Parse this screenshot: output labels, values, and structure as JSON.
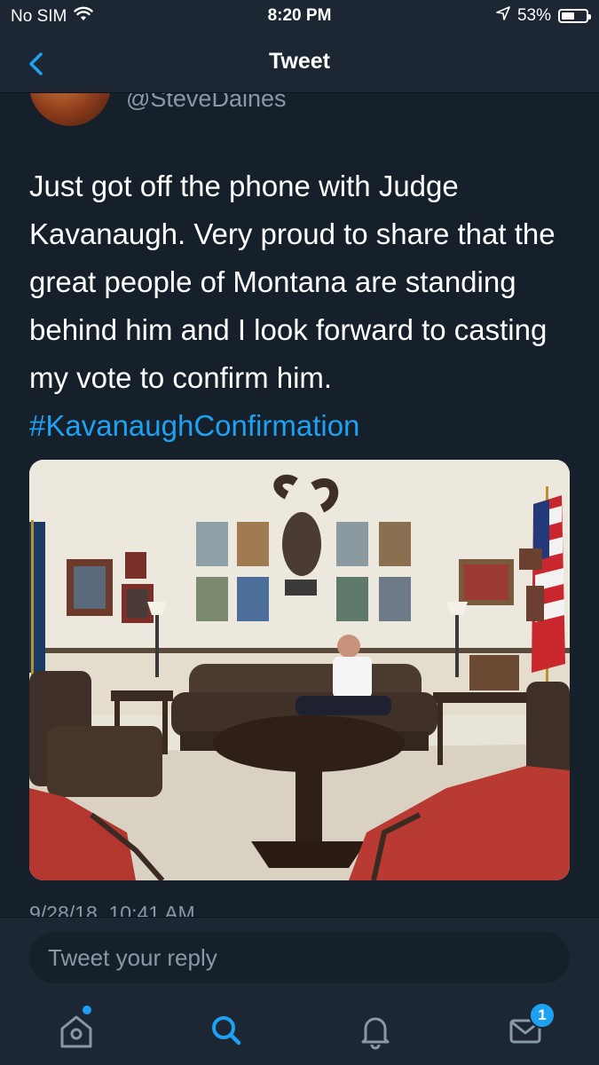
{
  "status_bar": {
    "carrier": "No SIM",
    "time": "8:20 PM",
    "battery_percent": "53%",
    "battery_level": 0.53,
    "icons": [
      "wifi-icon",
      "location-arrow-icon",
      "battery-icon"
    ]
  },
  "nav": {
    "title": "Tweet",
    "back_icon": "chevron-left-icon"
  },
  "tweet": {
    "handle": "@SteveDaines",
    "text": "Just got off the phone with Judge Kavanaugh. Very proud to share that the great people of Montana are standing behind him and I look forward to casting my vote to confirm him.",
    "hashtag": "#KavanaughConfirmation",
    "timestamp": "9/28/18, 10:41 AM"
  },
  "reply": {
    "placeholder": "Tweet your reply"
  },
  "tabs": {
    "home_icon": "home-icon",
    "search_icon": "search-icon",
    "notifications_icon": "bell-icon",
    "messages_icon": "mail-icon",
    "messages_badge": "1"
  },
  "colors": {
    "background": "#15202b",
    "bar": "#1c2733",
    "accent": "#1da1f2",
    "secondary_text": "#8899a6"
  }
}
